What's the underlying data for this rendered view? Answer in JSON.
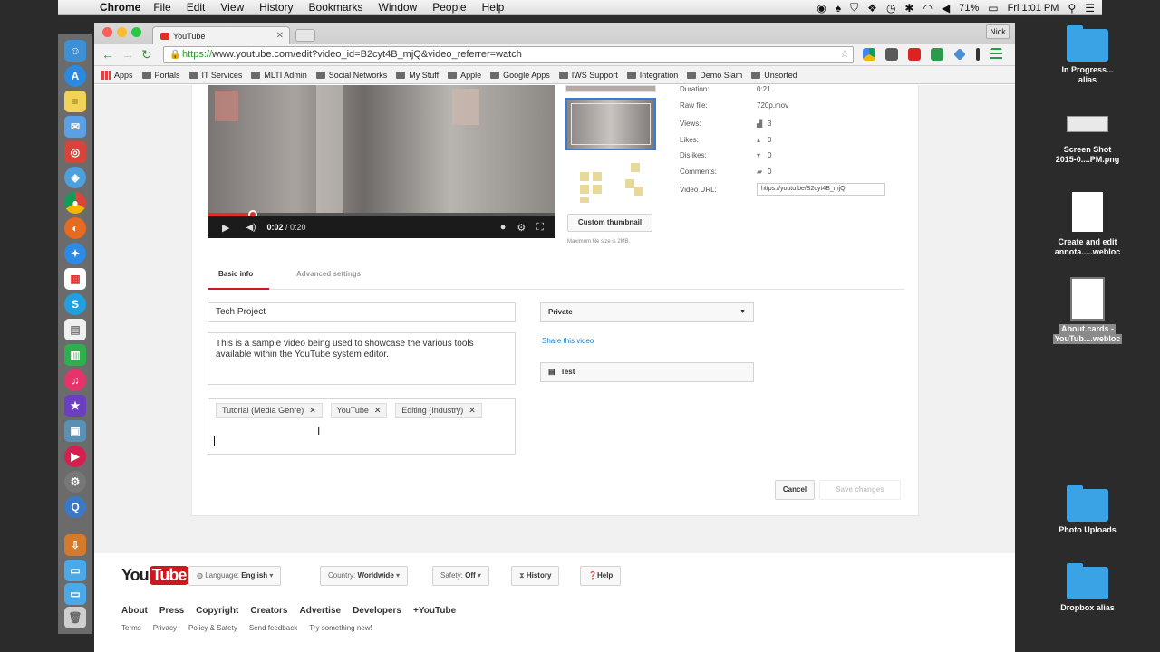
{
  "menubar": {
    "app": "Chrome",
    "items": [
      "File",
      "Edit",
      "View",
      "History",
      "Bookmarks",
      "Window",
      "People",
      "Help"
    ],
    "battery": "71%",
    "clock": "Fri 1:01 PM"
  },
  "browser": {
    "tab_title": "YouTube",
    "user": "Nick",
    "url_scheme": "https://",
    "url_rest": "www.youtube.com/edit?video_id=B2cyt4B_mjQ&video_referrer=watch",
    "bookmarks": [
      "Apps",
      "Portals",
      "IT Services",
      "MLTI Admin",
      "Social Networks",
      "My Stuff",
      "Apple",
      "Google Apps",
      "IWS Support",
      "Integration",
      "Demo Slam",
      "Unsorted"
    ]
  },
  "video": {
    "time_current": "0:02",
    "time_total": "/ 0:20",
    "progress": 0.13
  },
  "thumbnails": {
    "custom_button": "Custom thumbnail",
    "max_file": "Maximum file size is 2MB."
  },
  "meta": {
    "duration_label": "Duration:",
    "duration_value": "0:21",
    "raw_label": "Raw file:",
    "raw_value": "720p.mov",
    "views_label": "Views:",
    "views_value": "3",
    "likes_label": "Likes:",
    "likes_value": "0",
    "dislikes_label": "Dislikes:",
    "dislikes_value": "0",
    "comments_label": "Comments:",
    "comments_value": "0",
    "url_label": "Video URL:",
    "url_value": "https://youtu.be/B2cyt4B_mjQ"
  },
  "tabs": {
    "basic": "Basic info",
    "advanced": "Advanced settings"
  },
  "form": {
    "title": "Tech Project",
    "description": "This is a sample video being used to showcase the various tools available within the YouTube system editor.",
    "tags": [
      "Tutorial (Media Genre)",
      "YouTube",
      "Editing (Industry)"
    ],
    "privacy": "Private",
    "share": "Share this video",
    "playlist": "Test",
    "cancel": "Cancel",
    "save": "Save changes"
  },
  "footer": {
    "logo_you": "You",
    "logo_tube": "Tube",
    "language_label": "Language:",
    "language_value": "English",
    "country_label": "Country:",
    "country_value": "Worldwide",
    "safety_label": "Safety:",
    "safety_value": "Off",
    "history": "History",
    "help": "Help",
    "links": [
      "About",
      "Press",
      "Copyright",
      "Creators",
      "Advertise",
      "Developers",
      "+YouTube"
    ],
    "links2": [
      "Terms",
      "Privacy",
      "Policy & Safety",
      "Send feedback",
      "Try something new!"
    ]
  },
  "desktop": {
    "items": [
      {
        "label1": "In Progress...",
        "label2": "alias"
      },
      {
        "label1": "Screen Shot",
        "label2": "2015-0....PM.png"
      },
      {
        "label1": "Create and edit",
        "label2": "annota.....webloc"
      },
      {
        "label1": "About cards -",
        "label2": "YouTub....webloc"
      },
      {
        "label1": "Photo Uploads",
        "label2": ""
      },
      {
        "label1": "Dropbox alias",
        "label2": ""
      }
    ]
  }
}
